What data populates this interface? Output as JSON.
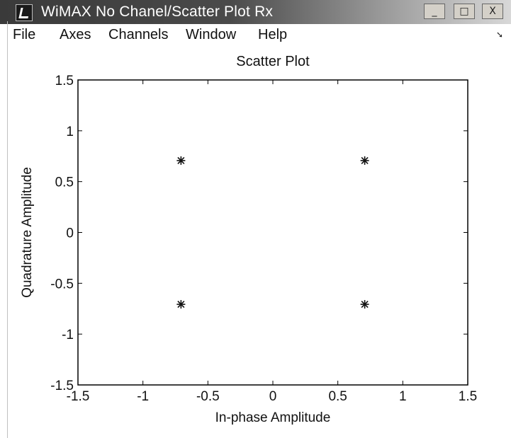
{
  "window": {
    "title": "WiMAX No Chanel/Scatter Plot Rx",
    "minimize_glyph": "_",
    "maximize_glyph": "□",
    "close_glyph": "X"
  },
  "menu": {
    "items": [
      "File",
      "Axes",
      "Channels",
      "Window",
      "Help"
    ]
  },
  "icons": {
    "app": "matlab-figure-icon",
    "menu_arrow": "dock-arrow-icon"
  },
  "chart_data": {
    "type": "scatter",
    "title": "Scatter Plot",
    "xlabel": "In-phase Amplitude",
    "ylabel": "Quadrature Amplitude",
    "xlim": [
      -1.5,
      1.5
    ],
    "ylim": [
      -1.5,
      1.5
    ],
    "xticks": [
      -1.5,
      -1,
      -0.5,
      0,
      0.5,
      1,
      1.5
    ],
    "yticks": [
      -1.5,
      -1,
      -0.5,
      0,
      0.5,
      1,
      1.5
    ],
    "xtick_labels": [
      "-1.5",
      "-1",
      "-0.5",
      "0",
      "0.5",
      "1",
      "1.5"
    ],
    "ytick_labels": [
      "-1.5",
      "-1",
      "-0.5",
      "0",
      "0.5",
      "1",
      "1.5"
    ],
    "grid": false,
    "marker": "*",
    "points": [
      {
        "x": -0.707,
        "y": 0.707
      },
      {
        "x": 0.707,
        "y": 0.707
      },
      {
        "x": -0.707,
        "y": -0.707
      },
      {
        "x": 0.707,
        "y": -0.707
      }
    ]
  }
}
